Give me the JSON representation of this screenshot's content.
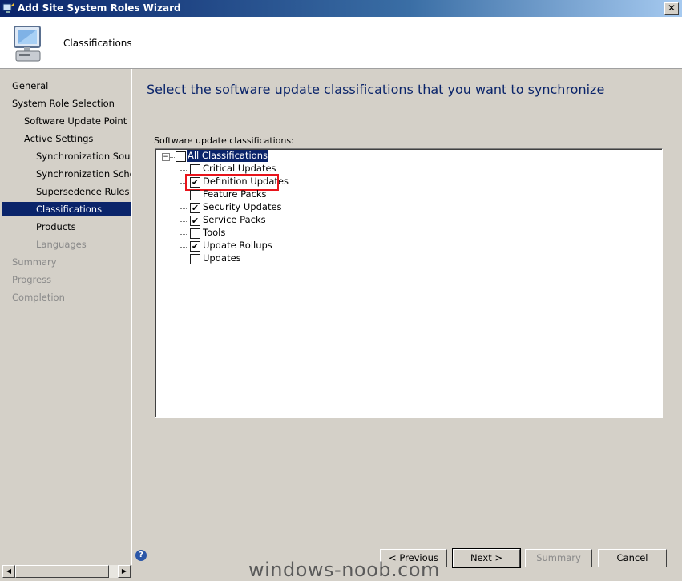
{
  "window": {
    "title": "Add Site System Roles Wizard",
    "close_label": "✕"
  },
  "header": {
    "title": "Classifications"
  },
  "nav": {
    "items": [
      {
        "label": "General",
        "state": "normal"
      },
      {
        "label": "System Role Selection",
        "state": "normal"
      },
      {
        "label": "Software Update Point",
        "state": "normal"
      },
      {
        "label": "Active Settings",
        "state": "normal"
      },
      {
        "label": "Synchronization Source",
        "state": "normal"
      },
      {
        "label": "Synchronization Schedule",
        "state": "normal"
      },
      {
        "label": "Supersedence Rules",
        "state": "normal"
      },
      {
        "label": "Classifications",
        "state": "selected"
      },
      {
        "label": "Products",
        "state": "normal"
      },
      {
        "label": "Languages",
        "state": "disabled"
      },
      {
        "label": "Summary",
        "state": "disabled"
      },
      {
        "label": "Progress",
        "state": "disabled"
      },
      {
        "label": "Completion",
        "state": "disabled"
      }
    ]
  },
  "main": {
    "heading": "Select the software update classifications that you want to synchronize",
    "tree_label": "Software update classifications:",
    "tree": {
      "expander": "−",
      "root": {
        "label": "All Classifications",
        "checked": false
      },
      "children": [
        {
          "label": "Critical Updates",
          "checked": false
        },
        {
          "label": "Definition Updates",
          "checked": true
        },
        {
          "label": "Feature Packs",
          "checked": false
        },
        {
          "label": "Security Updates",
          "checked": true
        },
        {
          "label": "Service Packs",
          "checked": true
        },
        {
          "label": "Tools",
          "checked": false
        },
        {
          "label": "Update Rollups",
          "checked": true
        },
        {
          "label": "Updates",
          "checked": false
        }
      ]
    }
  },
  "buttons": {
    "previous": "< Previous",
    "next": "Next >",
    "summary": "Summary",
    "cancel": "Cancel",
    "help": "?"
  },
  "scrollbar": {
    "left_arrow": "◀",
    "right_arrow": "▶"
  },
  "watermark": "windows-noob.com",
  "colors": {
    "accent": "#0a246a",
    "highlight_box": "#e8141b",
    "heading": "#0a246a"
  },
  "icons": {
    "app": "wizard-app-icon",
    "header": "computer-monitor-icon",
    "help": "help-icon"
  }
}
